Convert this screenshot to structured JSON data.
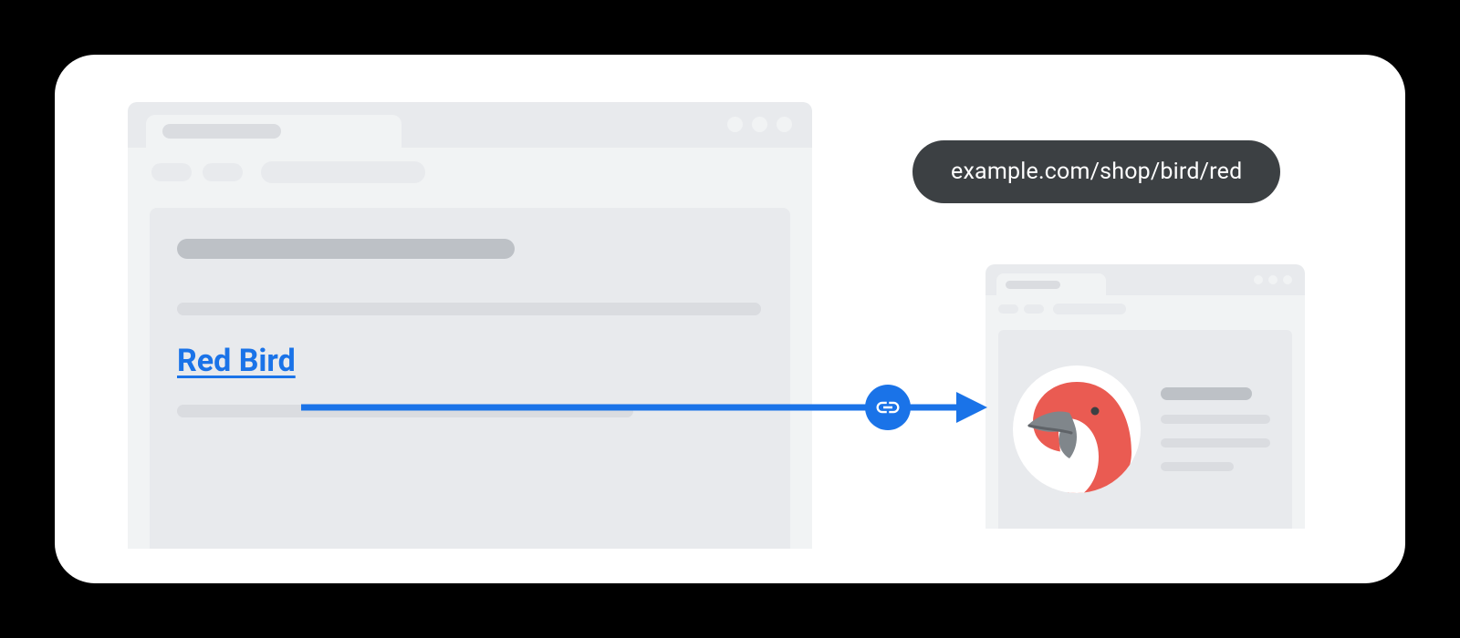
{
  "link": {
    "anchor_text": "Red Bird",
    "target_url": "example.com/shop/bird/red"
  },
  "colors": {
    "link_blue": "#1a73e8",
    "url_pill_bg": "#3c4043",
    "bird_red": "#ea5b52",
    "bird_beak": "#80868b"
  },
  "icons": {
    "link_badge": "link-icon",
    "arrow": "arrow-right"
  }
}
